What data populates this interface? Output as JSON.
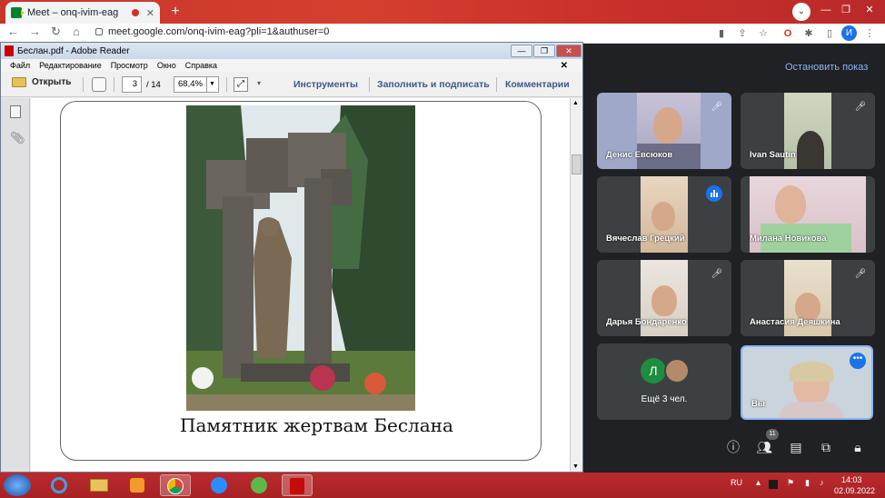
{
  "browser": {
    "tab_title": "Meet – onq-ivim-eag",
    "url": "meet.google.com/onq-ivim-eag?pli=1&authuser=0",
    "profile_initial": "И"
  },
  "adobe": {
    "window_title": "Беслан.pdf - Adobe Reader",
    "menu": [
      "Файл",
      "Редактирование",
      "Просмотр",
      "Окно",
      "Справка"
    ],
    "open_label": "Открыть",
    "page_current": "3",
    "page_total": "/ 14",
    "zoom": "68,4%",
    "tools_label": "Инструменты",
    "fill_sign_label": "Заполнить и подписать",
    "comments_label": "Комментарии",
    "caption": "Памятник жертвам Беслана"
  },
  "meet": {
    "stop_share": "Остановить показ",
    "participants": [
      {
        "name": "Денис Евсюков"
      },
      {
        "name": "Ivan Sautin"
      },
      {
        "name": "Вячеслав Грецкий"
      },
      {
        "name": "Милана Новикова"
      },
      {
        "name": "Дарья Бондаренко"
      },
      {
        "name": "Анастасия Деяшкина"
      }
    ],
    "more_initial": "Л",
    "more_label": "Ещё 3 чел.",
    "self_label": "Вы",
    "people_count": "11"
  },
  "taskbar": {
    "lang": "RU",
    "time": "14:03",
    "date": "02.09.2022"
  }
}
